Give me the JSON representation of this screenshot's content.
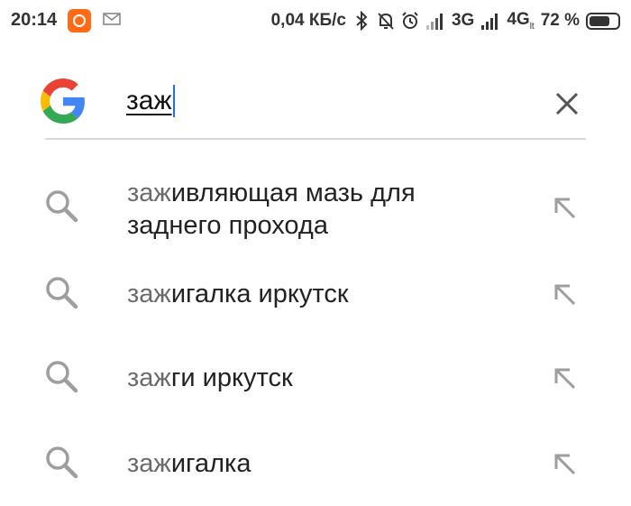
{
  "status_bar": {
    "time": "20:14",
    "network_speed": "0,04 КБ/с",
    "network_3g": "3G",
    "network_4g": "4G",
    "lte_small": "lt",
    "battery_percent": "72 %",
    "battery_level": 0.72,
    "icons": [
      "mi-app-icon",
      "mail-icon",
      "bluetooth-icon",
      "bell-muted-icon",
      "alarm-icon",
      "signal-icon",
      "signal-icon",
      "battery-icon"
    ]
  },
  "search": {
    "query": "заж",
    "logo": "google-g-logo",
    "clear_icon": "close-icon"
  },
  "suggestions": [
    {
      "prefix": "заж",
      "rest_line1": "ивляющая мазь для",
      "line2": "заднего прохода"
    },
    {
      "prefix": "заж",
      "rest_line1": "игалка иркутск",
      "line2": ""
    },
    {
      "prefix": "заж",
      "rest_line1": "ги иркутск",
      "line2": ""
    },
    {
      "prefix": "заж",
      "rest_line1": "игалка",
      "line2": ""
    }
  ],
  "colors": {
    "google_blue": "#4285F4",
    "google_red": "#EA4335",
    "google_yellow": "#FBBC05",
    "google_green": "#34A853",
    "caret": "#1a73e8",
    "mi_orange": "#ff6a14"
  }
}
